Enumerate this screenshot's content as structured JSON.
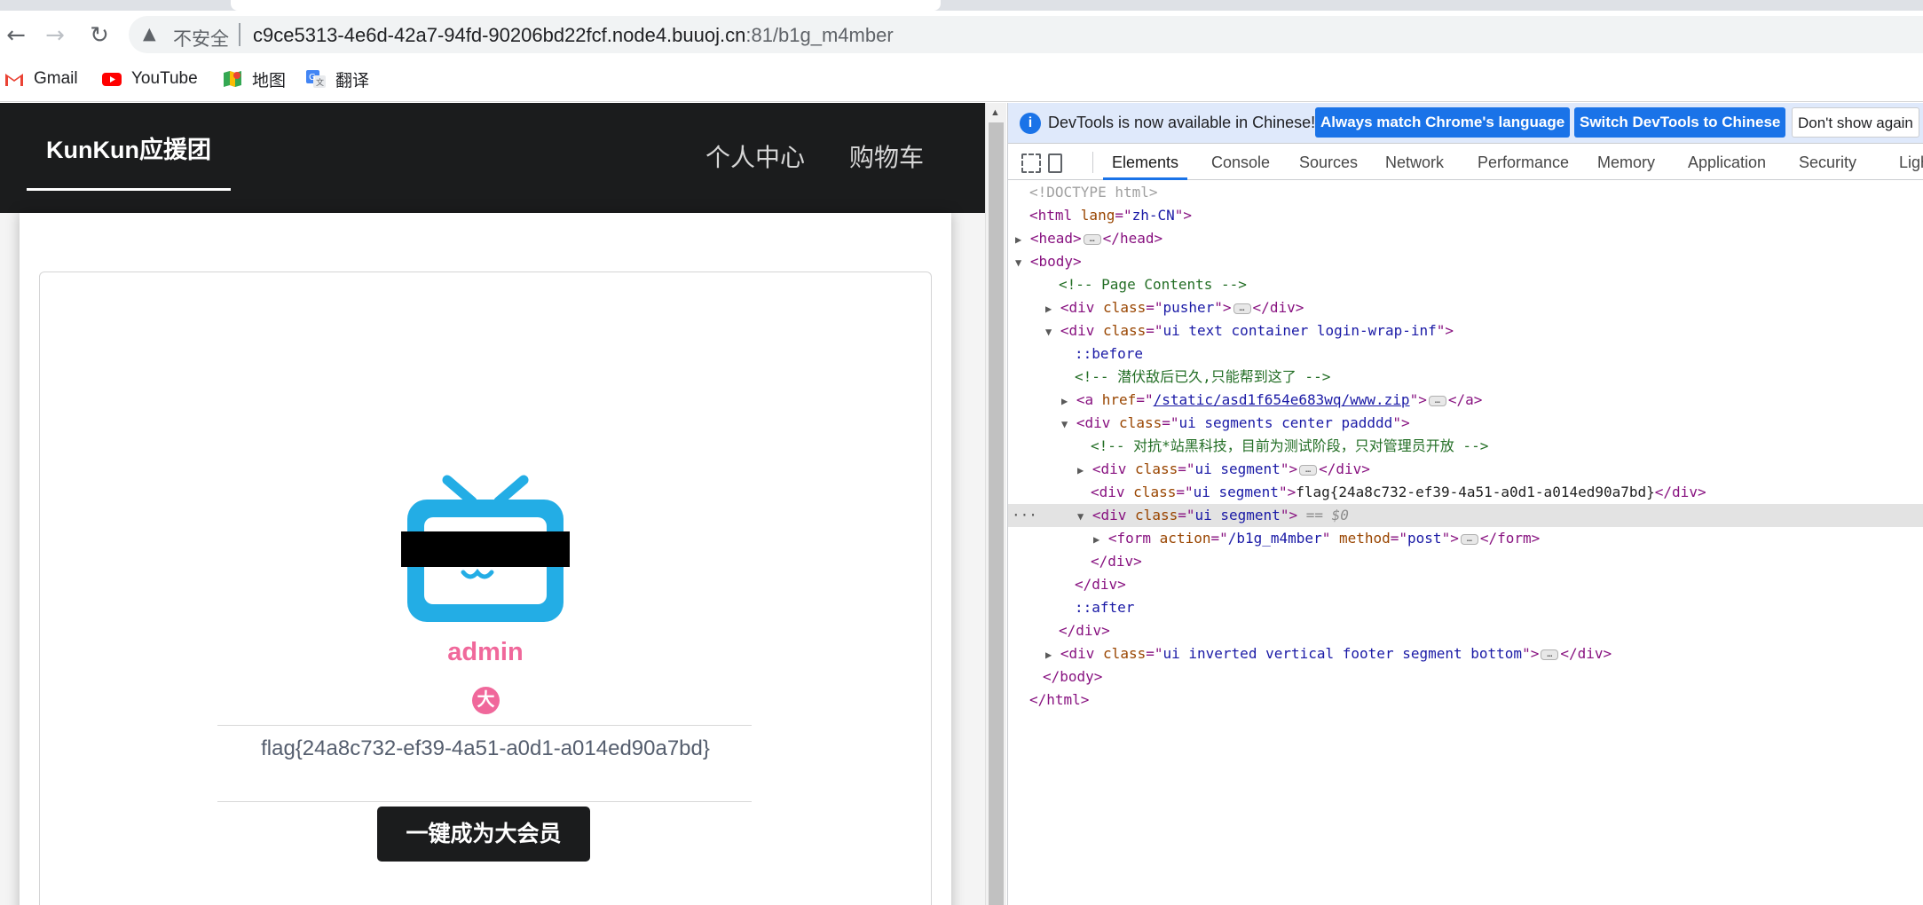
{
  "browser": {
    "nav": {
      "back": "←",
      "forward": "→",
      "reload": "↻"
    },
    "omnibox": {
      "security_label": "不安全",
      "url_host": "c9ce5313-4e6d-42a7-94fd-90206bd22fcf.node4.buuoj.cn",
      "url_rest": ":81/b1g_m4mber"
    },
    "bookmarks": [
      {
        "label": "Gmail",
        "icon": "gmail-icon"
      },
      {
        "label": "YouTube",
        "icon": "youtube-icon"
      },
      {
        "label": "地图",
        "icon": "maps-icon"
      },
      {
        "label": "翻译",
        "icon": "translate-icon"
      }
    ]
  },
  "site": {
    "brand": "KunKun应援团",
    "nav_links": [
      "个人中心",
      "购物车"
    ],
    "profile": {
      "username": "admin",
      "badge": "大",
      "flag": "flag{24a8c732-ef39-4a51-a0d1-a014ed90a7bd}",
      "vip_button": "一键成为大会员"
    }
  },
  "devtools": {
    "infobar": {
      "message": "DevTools is now available in Chinese!",
      "btn_match": "Always match Chrome's language",
      "btn_switch": "Switch DevTools to Chinese",
      "btn_dismiss": "Don't show again"
    },
    "tabs": [
      "Elements",
      "Console",
      "Sources",
      "Network",
      "Performance",
      "Memory",
      "Application",
      "Security",
      "Ligh"
    ],
    "active_tab": "Elements",
    "dom": {
      "doctype": "<!DOCTYPE html>",
      "html_lang": "zh-CN",
      "comment_page_contents": "<!-- Page Contents -->",
      "pusher_class": "pusher",
      "login_wrap_class": "ui text container login-wrap-inf",
      "before": "::before",
      "comment_hidden": "<!-- 潜伏敌后已久,只能帮到这了 -->",
      "zip_href": "/static/asd1f654e683wq/www.zip",
      "segments_class": "ui segments center padddd",
      "comment_test": "<!-- 对抗*站黑科技，目前为测试阶段，只对管理员开放 -->",
      "segment_class": "ui segment",
      "flag_text": "flag{24a8c732-ef39-4a51-a0d1-a014ed90a7bd}",
      "selected_marker": "== $0",
      "form_action": "/b1g_m4mber",
      "form_method": "post",
      "after": "::after",
      "footer_class": "ui inverted vertical footer segment bottom"
    }
  }
}
